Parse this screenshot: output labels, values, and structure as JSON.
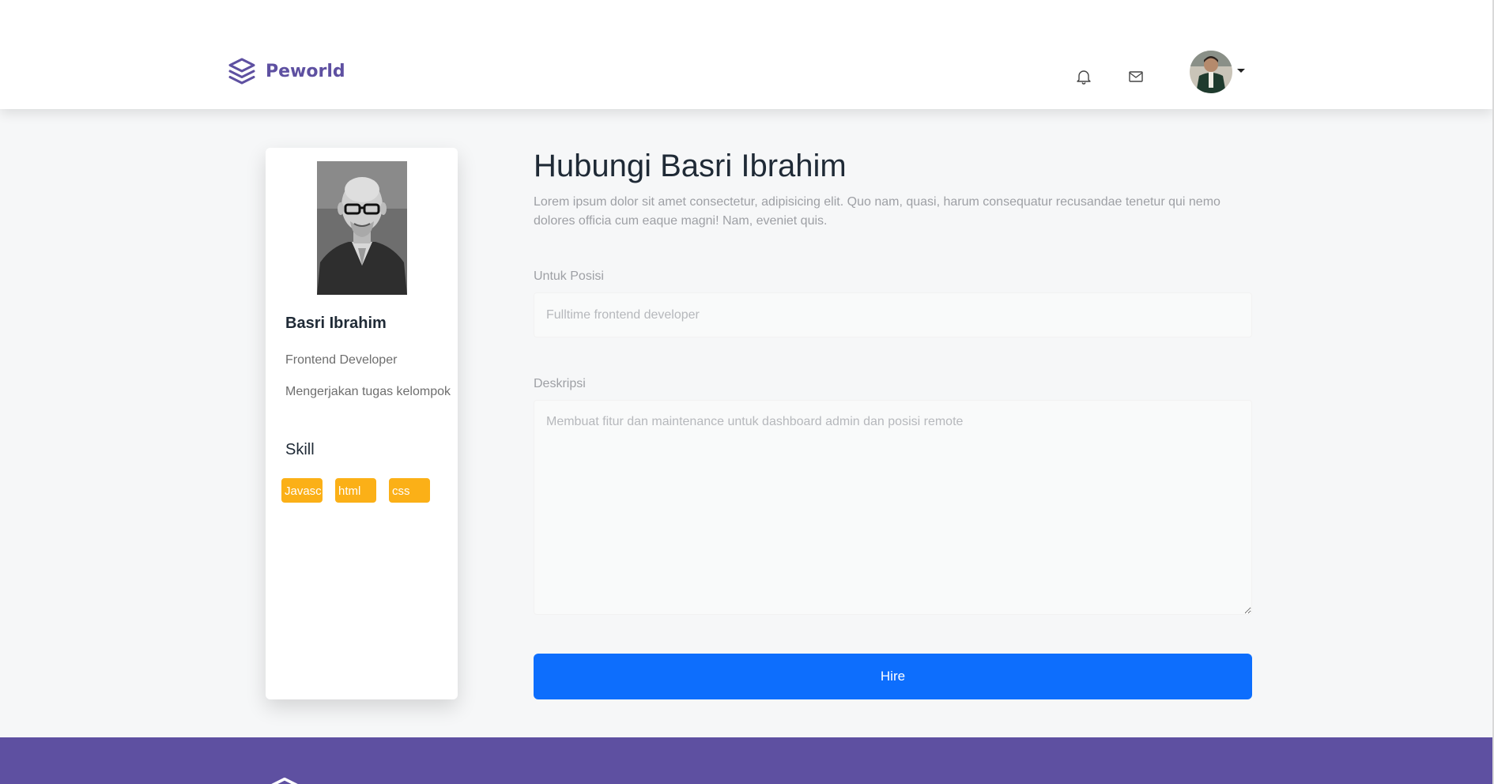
{
  "navbar": {
    "brand": "Peworld",
    "icons": {
      "notification": "bell-icon",
      "messages": "mail-icon",
      "account_menu": "caret-down-icon"
    },
    "brand_color": "#5e50a1"
  },
  "profile": {
    "name": "Basri Ibrahim",
    "job": "Frontend Developer",
    "status": "Mengerjakan tugas kelompok",
    "skill_heading": "Skill",
    "skills": [
      "Javascript",
      "html",
      "css"
    ],
    "skill_color": "#fbb017"
  },
  "form": {
    "title": "Hubungi Basri Ibrahim",
    "description": "Lorem ipsum dolor sit amet consectetur, adipisicing elit. Quo nam, quasi, harum consequatur recusandae tenetur qui nemo dolores officia cum eaque magni! Nam, eveniet quis.",
    "position_label": "Untuk Posisi",
    "position_placeholder": "Fulltime frontend developer",
    "description_label": "Deskripsi",
    "description_placeholder": "Membuat fitur dan maintenance untuk dashboard admin dan posisi remote",
    "submit_label": "Hire",
    "submit_color": "#0d6efd"
  },
  "footer": {
    "color": "#5e50a1"
  }
}
